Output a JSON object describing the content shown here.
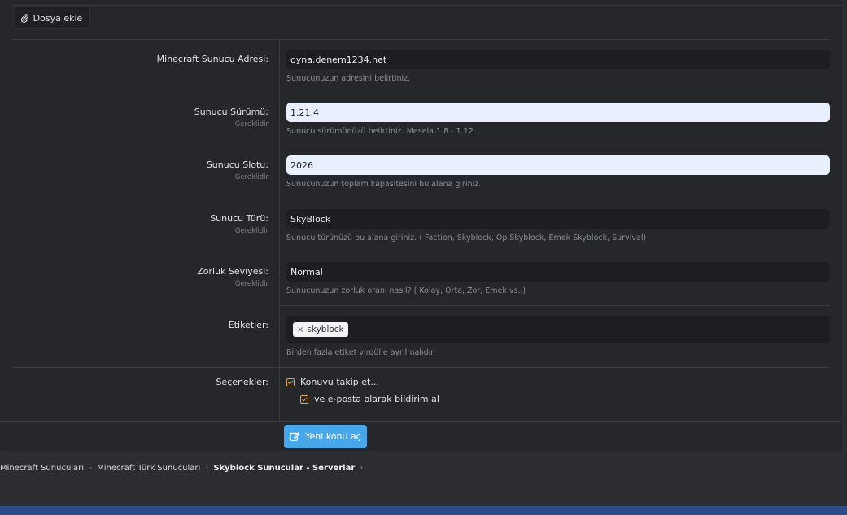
{
  "toolbar": {
    "attach_label": "Dosya ekle"
  },
  "fields": {
    "address": {
      "label": "Minecraft Sunucu Adresi:",
      "value": "oyna.denem1234.net",
      "hint": "Sunucunuzun adresini belirtiniz."
    },
    "version": {
      "label": "Sunucu Sürümü:",
      "required": "Gereklidir",
      "value": "1.21.4",
      "hint": "Sunucu sürümünüzü belirtiniz. Mesela 1.8 - 1.12"
    },
    "slot": {
      "label": "Sunucu Slotu:",
      "required": "Gereklidir",
      "value": "2026",
      "hint": "Sunucunuzun toplam kapasitesini bu alana giriniz."
    },
    "type": {
      "label": "Sunucu Türü:",
      "required": "Gereklidir",
      "value": "SkyBlock",
      "hint": "Sunucu türünüzü bu alana giriniz. ( Faction, Skyblock, Op Skyblock, Emek Skyblock, Survival)"
    },
    "difficulty": {
      "label": "Zorluk Seviyesi:",
      "required": "Gereklidir",
      "value": "Normal",
      "hint": "Sunucunuzun zorluk oranı nasıl? ( Kolay, Orta, Zor, Emek vs..)"
    },
    "tags": {
      "label": "Etiketler:",
      "items": [
        "skyblock"
      ],
      "hint": "Birden fazla etiket virgülle ayrılmalıdır."
    }
  },
  "options": {
    "label": "Seçenekler:",
    "watch": "Konuyu takip et...",
    "email": "ve e-posta olarak bildirim al"
  },
  "submit": {
    "label": "Yeni konu aç"
  },
  "breadcrumb": [
    "Minecraft Sunucuları",
    "Minecraft Türk Sunucuları",
    "Skyblock Sunucular - Serverlar"
  ],
  "colors": {
    "accent": "#47a7eb",
    "checkbox": "#e0a53a",
    "panel": "#25272b",
    "page": "#2b2d31"
  }
}
